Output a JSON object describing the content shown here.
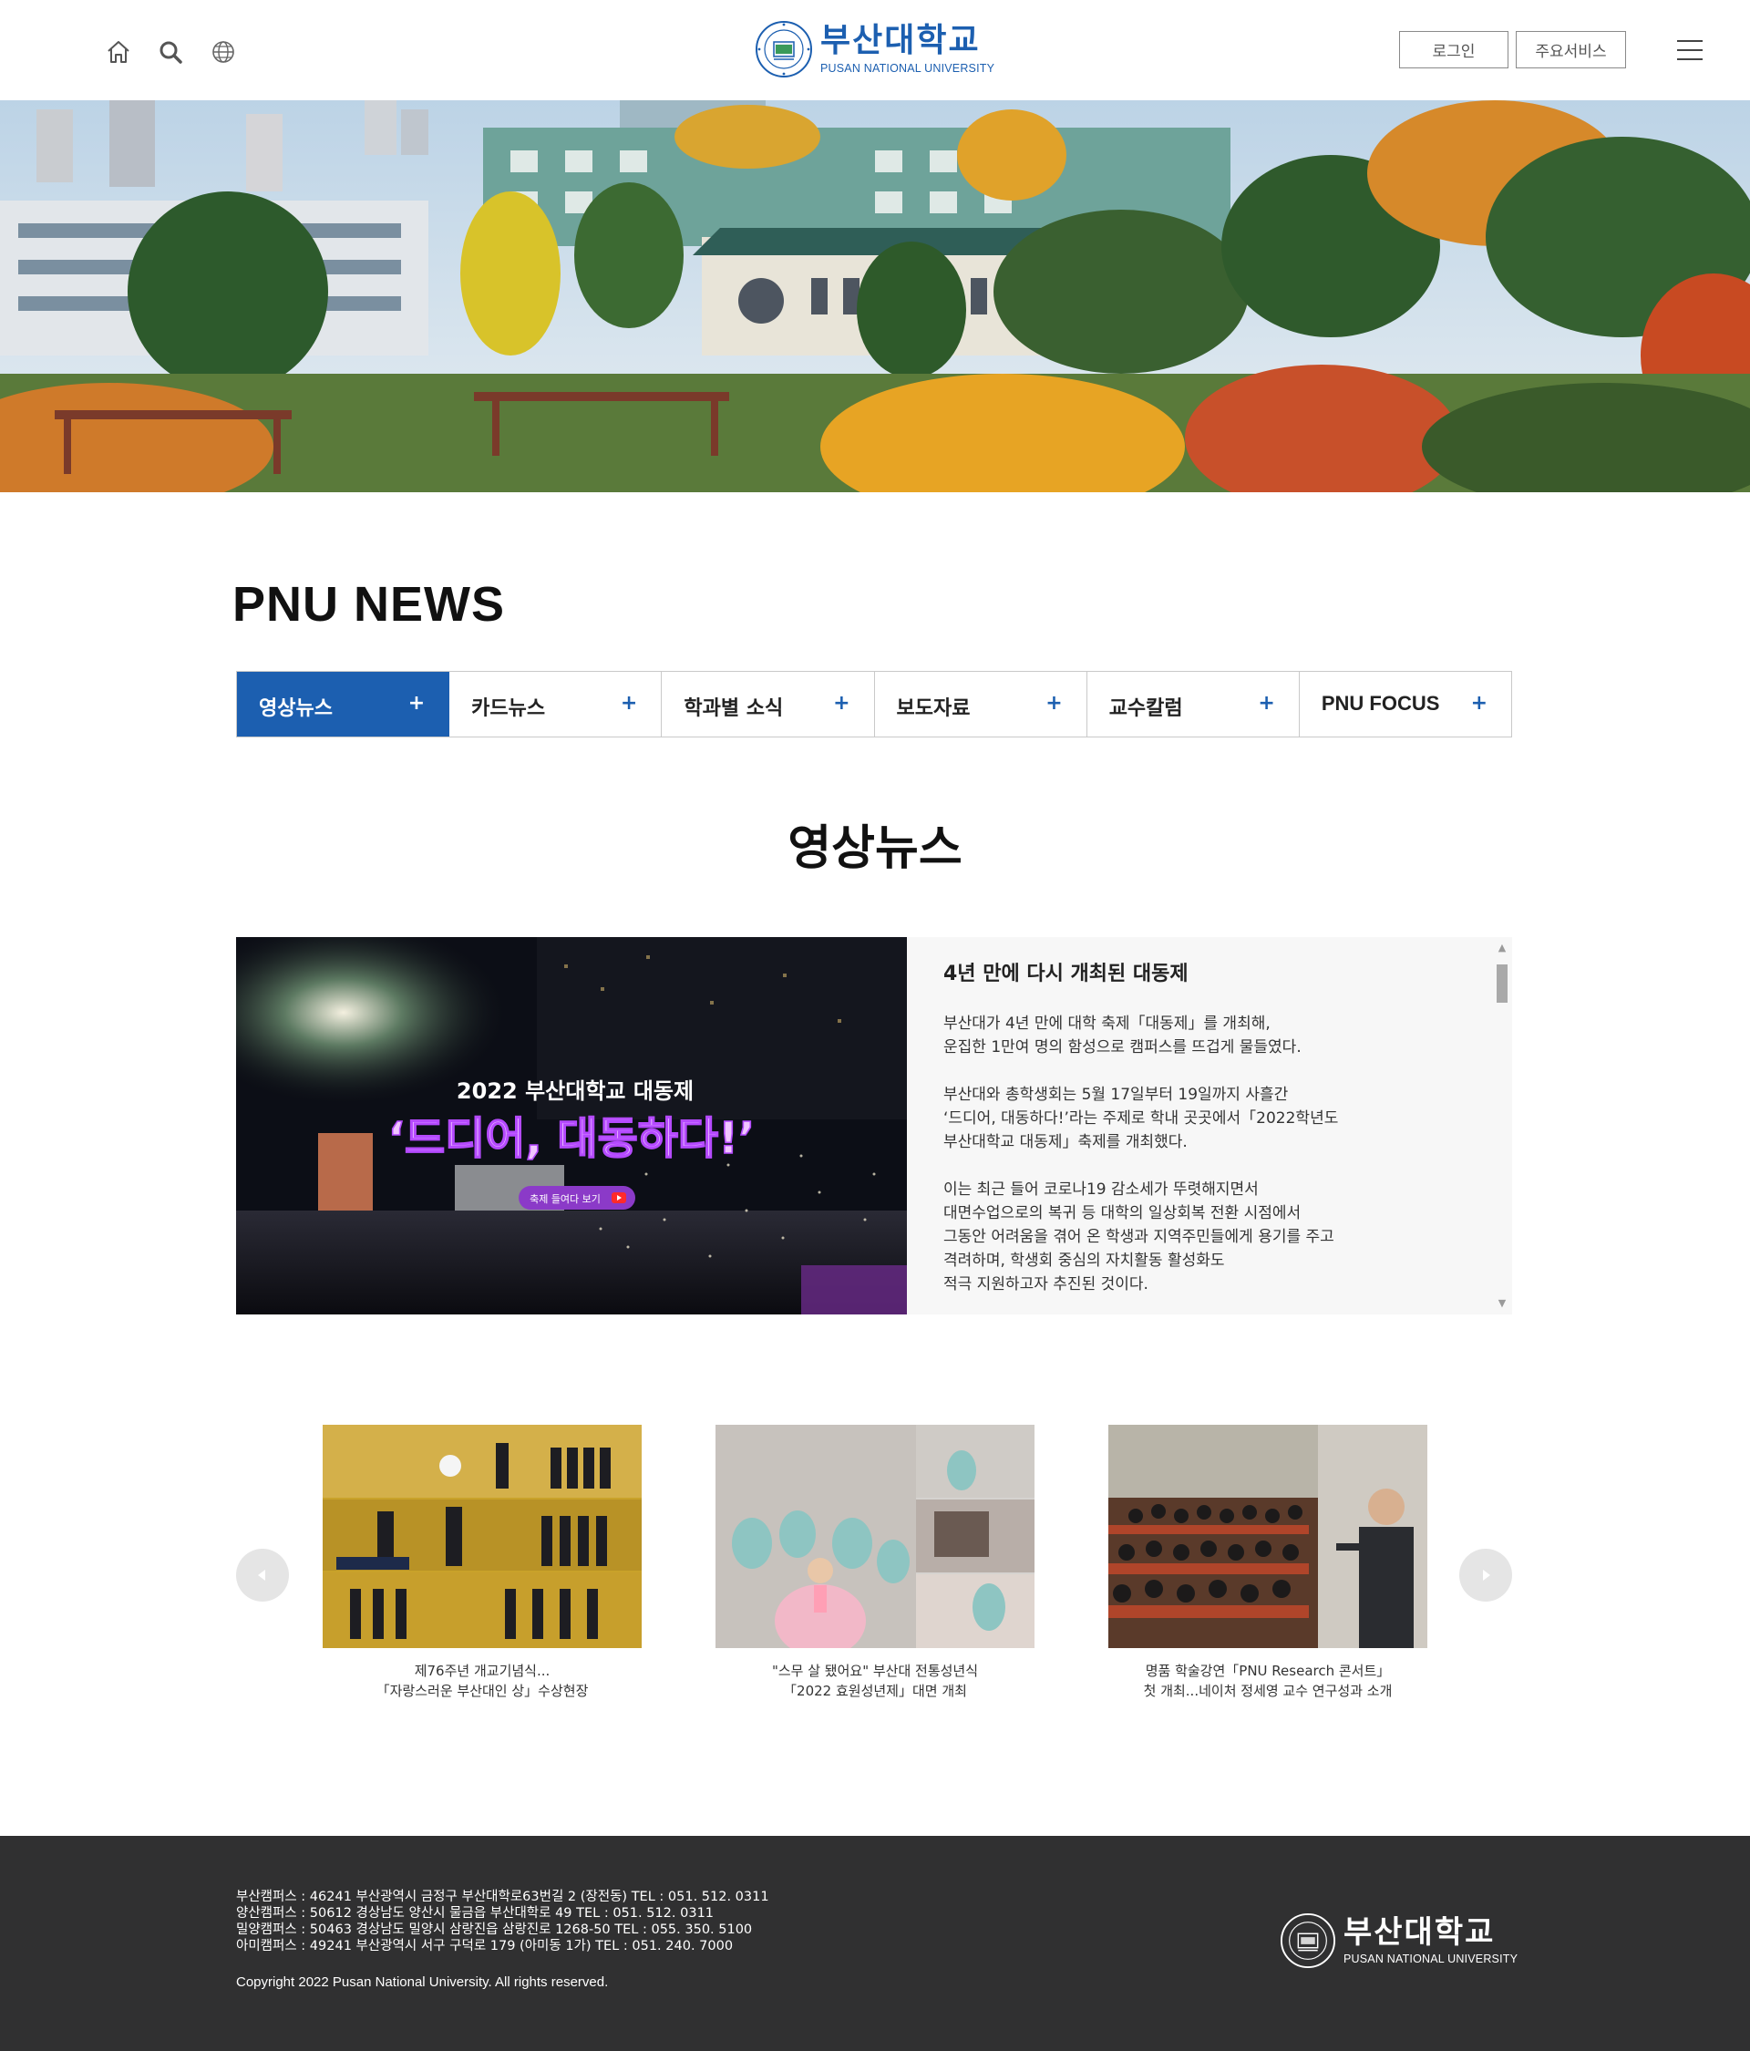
{
  "header": {
    "logo_kr": "부산대학교",
    "logo_en": "PUSAN NATIONAL UNIVERSITY",
    "login_label": "로그인",
    "services_label": "주요서비스",
    "icons": [
      "home-icon",
      "search-icon",
      "globe-icon",
      "hamburger-menu-icon"
    ]
  },
  "news": {
    "section_title": "PNU NEWS",
    "tabs": [
      {
        "label": "영상뉴스",
        "active": true
      },
      {
        "label": "카드뉴스",
        "active": false
      },
      {
        "label": "학과별 소식",
        "active": false
      },
      {
        "label": "보도자료",
        "active": false
      },
      {
        "label": "교수칼럼",
        "active": false
      },
      {
        "label": "PNU FOCUS",
        "active": false
      }
    ],
    "tab_plus": "+",
    "sub_title": "영상뉴스",
    "feature": {
      "image_text_line1": "2022 부산대학교 대동제",
      "image_text_line2": "‘드디어, 대동하다!’",
      "image_button": "축제 들여다 보기",
      "heading": "4년 만에 다시 개최된 대동제",
      "paragraphs": [
        "부산대가 4년 만에 대학 축제「대동제」를 개최해,\n운집한 1만여 명의 함성으로 캠퍼스를 뜨겁게 물들였다.",
        "부산대와 총학생회는 5월 17일부터 19일까지 사흘간\n‘드디어, 대동하다!’라는 주제로 학내 곳곳에서「2022학년도\n부산대학교 대동제」축제를 개최했다.",
        "이는 최근 들어 코로나19 감소세가 뚜렷해지면서\n대면수업으로의 복귀 등 대학의 일상회복 전환 시점에서\n그동안 어려움을 겪어 온 학생과 지역주민들에게 용기를 주고\n격려하며, 학생회 중심의 자치활동 활성화도\n적극 지원하고자 추진된 것이다."
      ]
    },
    "cards": [
      {
        "line1": "제76주년 개교기념식...",
        "line2": "「자랑스러운 부산대인 상」수상현장"
      },
      {
        "line1": "\"스무 살 됐어요\" 부산대 전통성년식",
        "line2": "「2022 효원성년제」대면 개최"
      },
      {
        "line1": "명품 학술강연「PNU Research 콘서트」",
        "line2": "첫 개최...네이처 정세영 교수 연구성과 소개"
      }
    ]
  },
  "footer": {
    "addresses": [
      "부산캠퍼스 : 46241 부산광역시 금정구 부산대학로63번길 2 (장전동) TEL : 051. 512. 0311",
      "양산캠퍼스 : 50612 경상남도 양산시 물금읍 부산대학로 49 TEL : 051. 512. 0311",
      "밀양캠퍼스 : 50463 경상남도 밀양시 삼랑진읍 삼랑진로 1268-50 TEL : 055. 350. 5100",
      "아미캠퍼스 : 49241 부산광역시 서구 구덕로 179 (아미동 1가) TEL : 051. 240. 7000"
    ],
    "copyright": "Copyright 2022 Pusan National University. All rights reserved.",
    "logo_kr": "부산대학교",
    "logo_en": "PUSAN NATIONAL UNIVERSITY"
  },
  "colors": {
    "brand_blue": "#1c5fb0",
    "footer_bg": "#303031",
    "feature_bg": "#f7f7f7"
  }
}
